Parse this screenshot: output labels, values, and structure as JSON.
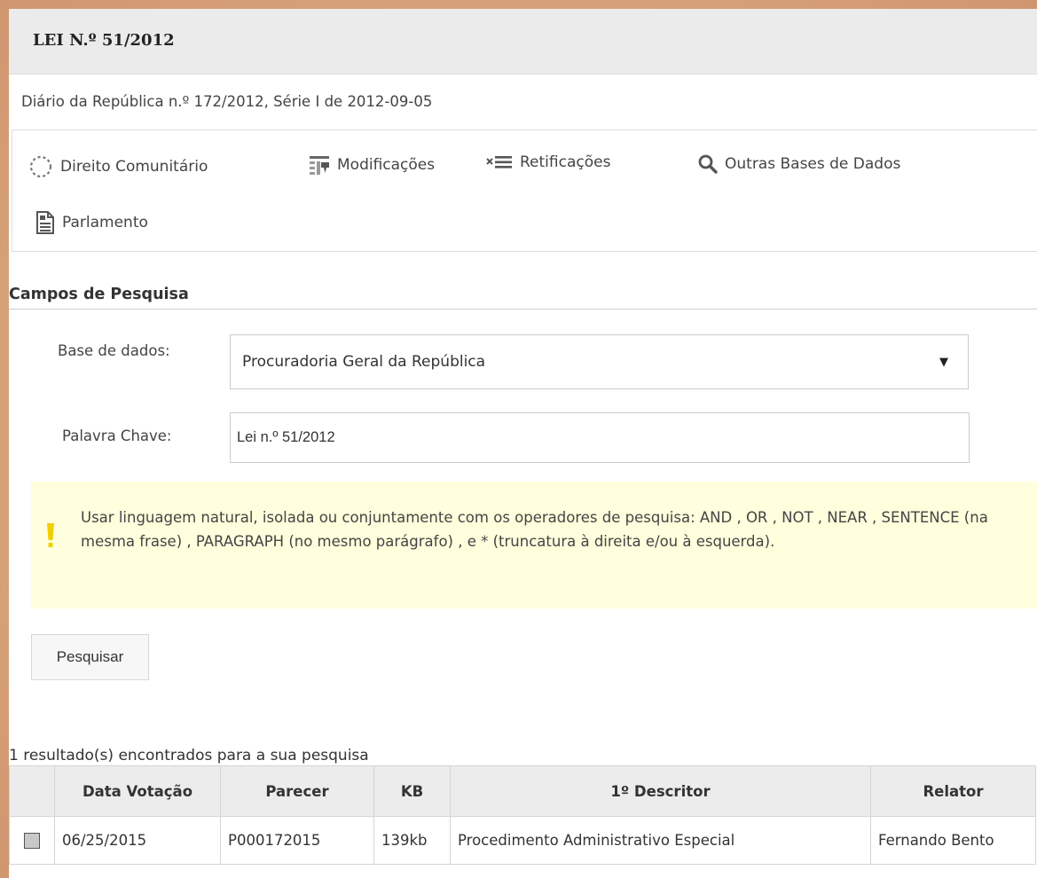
{
  "header": {
    "title": "LEI N.º 51/2012",
    "diario": "Diário da República n.º 172/2012, Série I de 2012-09-05"
  },
  "links": [
    {
      "label": "Direito Comunitário",
      "icon": "dotted-circle-icon"
    },
    {
      "label": "Modificações",
      "icon": "table-arrow-icon"
    },
    {
      "label": "Retificações",
      "icon": "list-x-icon"
    },
    {
      "label": "Outras Bases de Dados",
      "icon": "search-icon"
    },
    {
      "label": "Parlamento",
      "icon": "document-icon"
    }
  ],
  "search": {
    "section_title": "Campos de Pesquisa",
    "database_label": "Base de dados:",
    "database_value": "Procuradoria Geral da República",
    "keyword_label": "Palavra Chave:",
    "keyword_value": "Lei n.º 51/2012",
    "help_text": "Usar linguagem natural, isolada ou conjuntamente com os operadores de pesquisa: AND , OR , NOT , NEAR , SENTENCE (na mesma frase) , PARAGRAPH (no mesmo parágrafo) , e * (truncatura à direita e/ou à esquerda).",
    "button_label": "Pesquisar"
  },
  "results": {
    "summary": "1 resultado(s) encontrados para a sua pesquisa",
    "columns": [
      "Data Votação",
      "Parecer",
      "KB",
      "1º Descritor",
      "Relator"
    ],
    "rows": [
      {
        "data": "06/25/2015",
        "parecer": "P000172015",
        "kb": "139kb",
        "descritor": "Procedimento Administrativo Especial",
        "relator": "Fernando Bento"
      }
    ]
  },
  "colors": {
    "background": "#d9a57c",
    "header_bg": "#ebebeb",
    "alert_bg": "#ffffdd",
    "alert_icon": "#f0d000"
  }
}
